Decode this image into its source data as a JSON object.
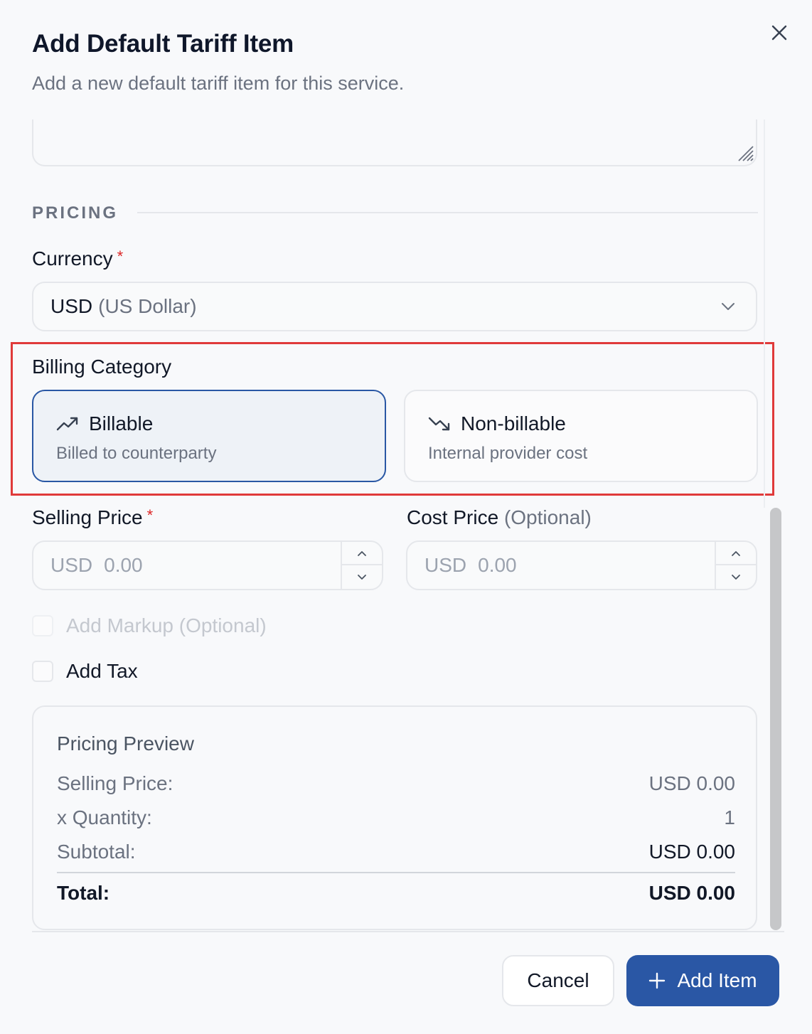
{
  "dialog": {
    "title": "Add Default Tariff Item",
    "subtitle": "Add a new default tariff item for this service."
  },
  "pricing": {
    "section_label": "PRICING",
    "currency": {
      "label": "Currency",
      "required_mark": "*",
      "selected_code": "USD",
      "selected_name": "(US Dollar)"
    },
    "billing_category": {
      "label": "Billing Category",
      "options": [
        {
          "title": "Billable",
          "description": "Billed to counterparty",
          "icon": "trending-up-icon",
          "selected": true
        },
        {
          "title": "Non-billable",
          "description": "Internal provider cost",
          "icon": "trending-down-icon",
          "selected": false
        }
      ]
    },
    "selling_price": {
      "label": "Selling Price",
      "required_mark": "*",
      "currency": "USD",
      "placeholder": "0.00"
    },
    "cost_price": {
      "label": "Cost Price",
      "optional_text": "(Optional)",
      "currency": "USD",
      "placeholder": "0.00"
    },
    "add_markup": {
      "label": "Add Markup (Optional)",
      "checked": false,
      "disabled": true
    },
    "add_tax": {
      "label": "Add Tax",
      "checked": false
    }
  },
  "preview": {
    "title": "Pricing Preview",
    "rows": [
      {
        "label": "Selling Price:",
        "value": "USD 0.00"
      },
      {
        "label": "x Quantity:",
        "value": "1"
      },
      {
        "label": "Subtotal:",
        "value": "USD 0.00"
      }
    ],
    "total": {
      "label": "Total:",
      "value": "USD 0.00"
    }
  },
  "footer": {
    "cancel_label": "Cancel",
    "add_label": "Add Item"
  },
  "colors": {
    "primary": "#2a57a5",
    "selected_border": "#2957a4",
    "required": "#dc2626",
    "highlight": "#e03a3a"
  }
}
